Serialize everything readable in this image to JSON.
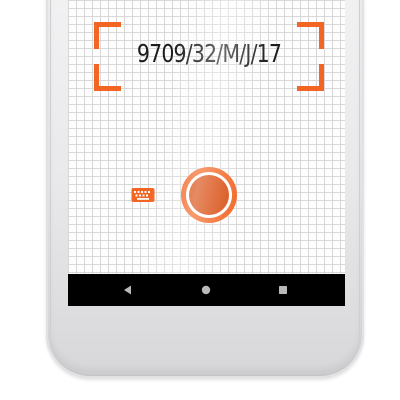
{
  "scanner": {
    "recognized_text": "9709/32/M/J/17"
  },
  "icons": {
    "keyboard": "keyboard-icon",
    "shutter": "camera-shutter-icon",
    "back": "back-triangle-icon",
    "home": "home-circle-icon",
    "recents": "recents-square-icon"
  },
  "colors": {
    "accent": "#f26522",
    "shutter_core": "#d84c0f",
    "navbar": "#000000",
    "nav_icon": "#b9b9b9",
    "grid_line": "#d8d8d8"
  }
}
